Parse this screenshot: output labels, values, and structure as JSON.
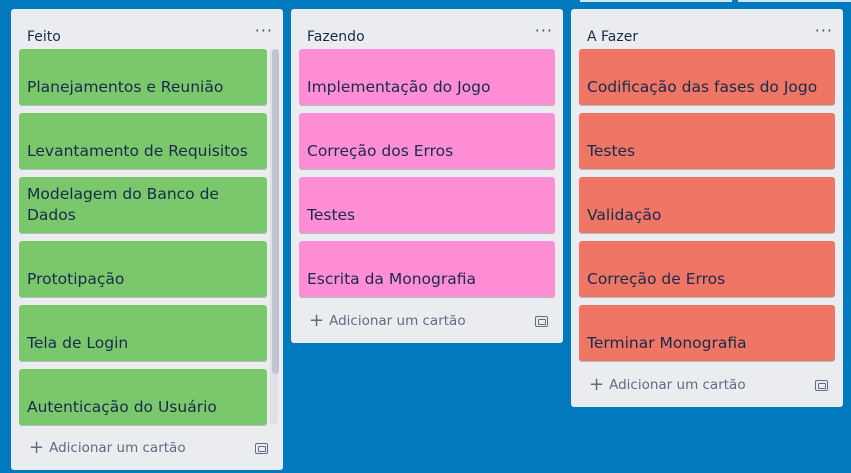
{
  "board": {
    "background": "#0079bf"
  },
  "lists": [
    {
      "title": "Feito",
      "menu": "···",
      "color": "#7bc86c",
      "cards": [
        "Planejamentos e Reunião",
        "Levantamento de Requisitos",
        "Modelagem do Banco de Dados",
        "Prototipação",
        "Tela de Login",
        "Autenticação do Usuário"
      ],
      "add_label": "Adicionar um cartão"
    },
    {
      "title": "Fazendo",
      "menu": "···",
      "color": "#ff8ed4",
      "cards": [
        "Implementação do Jogo",
        "Correção dos Erros",
        "Testes",
        "Escrita da Monografia"
      ],
      "add_label": "Adicionar um cartão"
    },
    {
      "title": "A Fazer",
      "menu": "···",
      "color": "#ef7564",
      "cards": [
        "Codificação das fases do Jogo",
        "Testes",
        "Validação",
        "Correção de Erros",
        "Terminar Monografia"
      ],
      "add_label": "Adicionar um cartão"
    }
  ],
  "icons": {
    "plus": "+",
    "add_icon_name": "plus-icon",
    "template_icon_name": "card-template-icon",
    "menu_icon_name": "list-menu-icon"
  }
}
